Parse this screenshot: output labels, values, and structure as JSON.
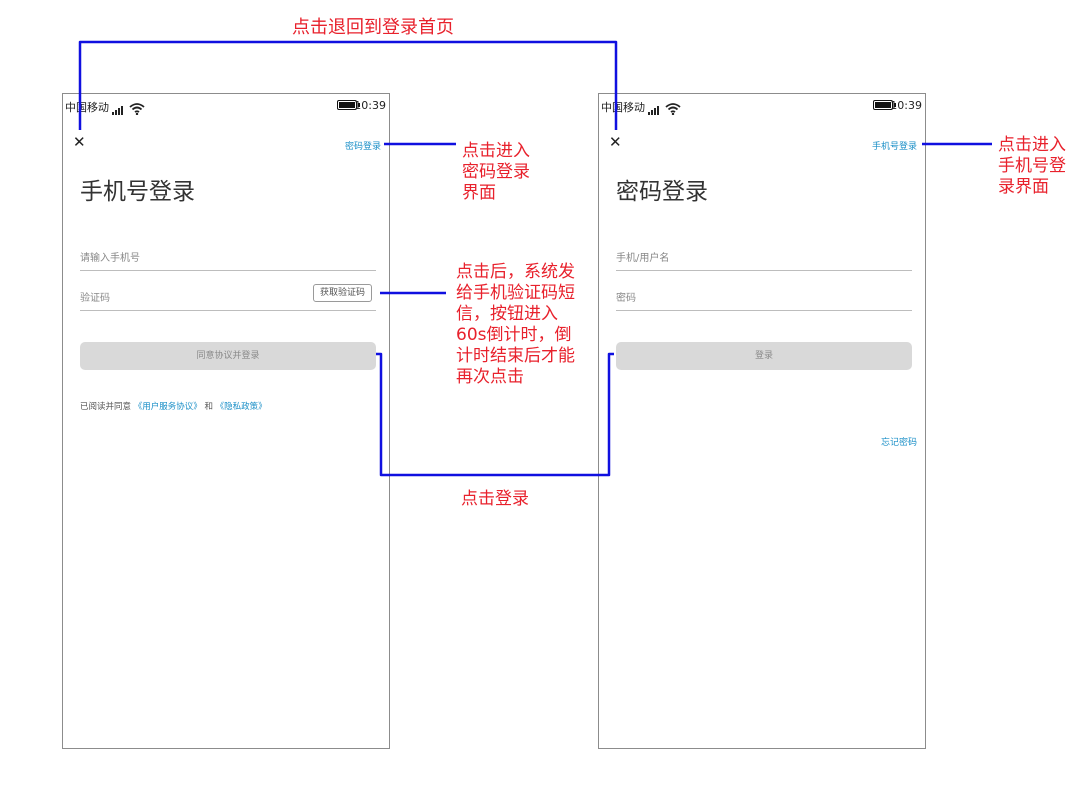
{
  "phone_left": {
    "status": {
      "carrier": "中国移动",
      "time": "10:39"
    },
    "password_login_link": "密码登录",
    "title": "手机号登录",
    "phone_placeholder": "请输入手机号",
    "code_placeholder": "验证码",
    "get_code_button": "获取验证码",
    "login_button": "同意协议并登录",
    "agreement": {
      "prefix": "已阅读并同意",
      "user_agreement": "《用户服务协议》",
      "and": "和",
      "privacy_policy": "《隐私政策》"
    }
  },
  "phone_right": {
    "status": {
      "carrier": "中国移动",
      "time": "10:39"
    },
    "phone_login_link": "手机号登录",
    "title": "密码登录",
    "username_placeholder": "手机/用户名",
    "password_placeholder": "密码",
    "login_button": "登录",
    "forgot_password": "忘记密码"
  },
  "annotations": {
    "back_to_home": "点击退回到登录首页",
    "to_password": [
      "点击进入",
      "密码登录",
      "界面"
    ],
    "get_code": [
      "点击后，系统发",
      "给手机验证码短",
      "信，按钮进入",
      "60s倒计时，倒",
      "计时结束后才能",
      "再次点击"
    ],
    "click_login": "点击登录",
    "to_phone": [
      "点击进入",
      "手机号登",
      "录界面"
    ]
  },
  "colors": {
    "annotation": "#e8212c",
    "connector": "#1010e0",
    "link": "#1a8fc7"
  }
}
